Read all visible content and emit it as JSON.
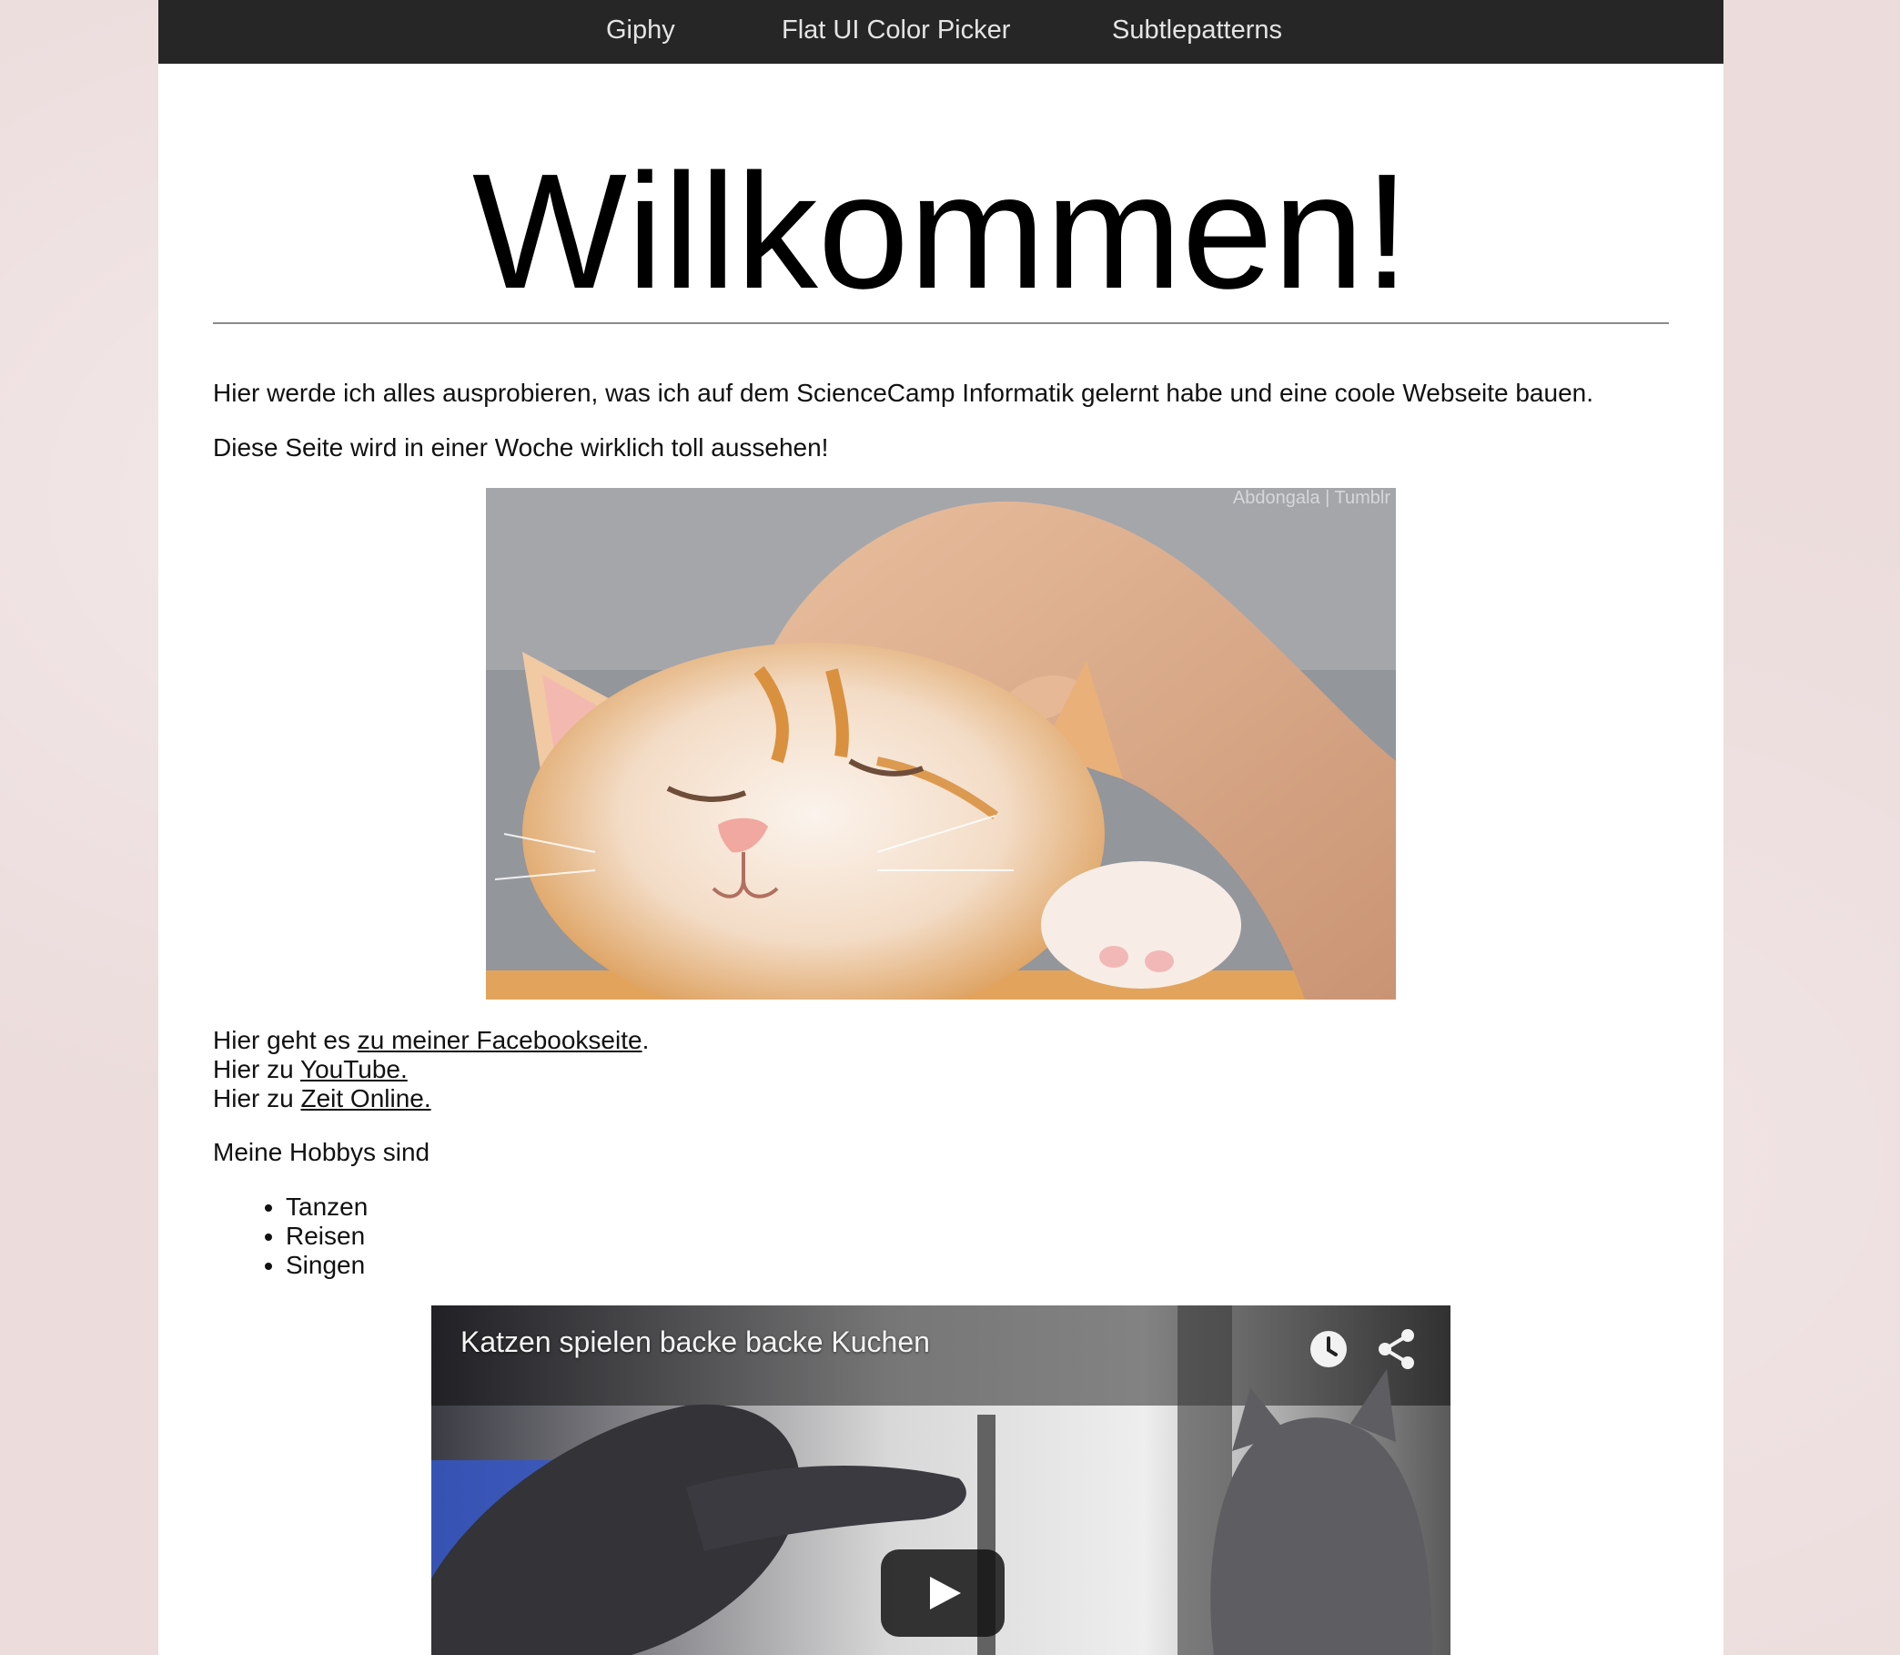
{
  "nav": {
    "items": [
      "Giphy",
      "Flat UI Color Picker",
      "Subtlepatterns"
    ]
  },
  "main": {
    "title": "Willkommen!",
    "paragraph1": "Hier werde ich alles ausprobieren, was ich auf dem ScienceCamp Informatik gelernt habe und eine coole Webseite bauen.",
    "paragraph2": "Diese Seite wird in einer Woche wirklich toll aussehen!",
    "image_watermark": "Abdongala | Tumblr",
    "links": {
      "facebook_prefix": "Hier geht es ",
      "facebook_link": "zu meiner Facebookseite",
      "facebook_suffix": ".",
      "youtube_prefix": "Hier zu ",
      "youtube_link": "YouTube.",
      "zeit_prefix": "Hier zu ",
      "zeit_link": "Zeit Online."
    },
    "hobbies_title": "Meine Hobbys sind",
    "hobbies": [
      "Tanzen",
      "Reisen",
      "Singen"
    ]
  },
  "video": {
    "title": "Katzen spielen backe backe Kuchen",
    "icons": [
      "clock-icon",
      "share-icon",
      "play-icon"
    ]
  },
  "colors": {
    "navbar": "#262626",
    "page_background": "#ecdcdc",
    "content_background": "#ffffff"
  }
}
